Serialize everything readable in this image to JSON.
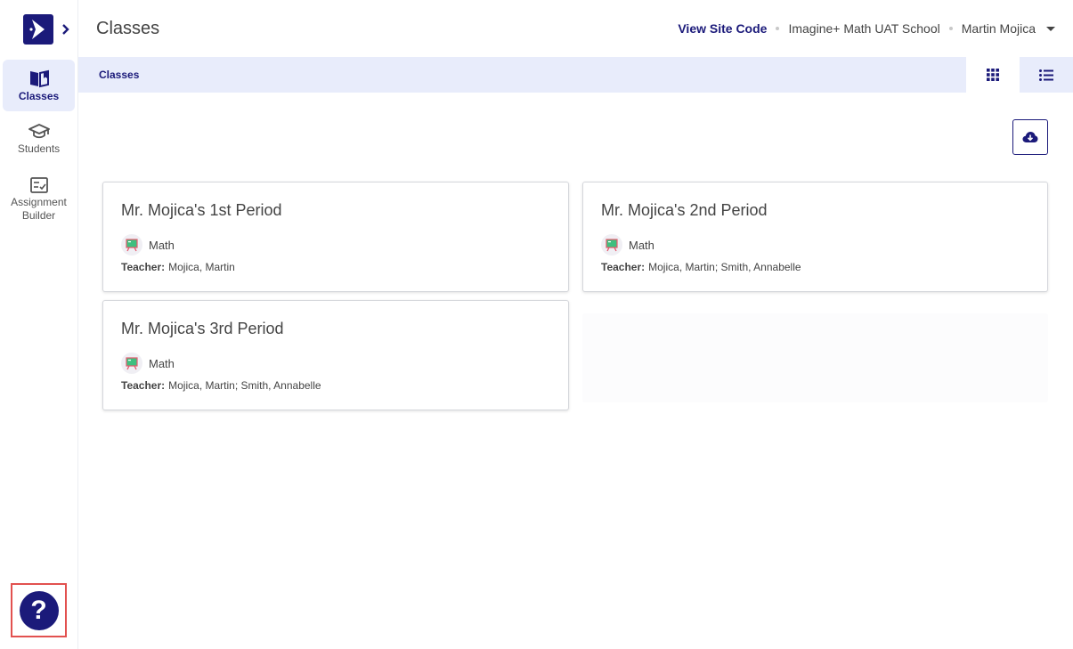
{
  "header": {
    "title": "Classes",
    "site_code_label": "View Site Code",
    "school": "Imagine+ Math UAT School",
    "user": "Martin Mojica"
  },
  "sidebar": {
    "items": [
      {
        "label": "Classes",
        "icon": "book-open-icon",
        "active": true
      },
      {
        "label": "Students",
        "icon": "graduation-cap-icon",
        "active": false
      },
      {
        "label": "Assignment Builder",
        "icon": "checklist-icon",
        "active": false
      }
    ],
    "help_label": "?"
  },
  "breadcrumb": {
    "items": [
      "Classes"
    ]
  },
  "colors": {
    "brand": "#1b1a7a",
    "active_bg": "#e8ecfb",
    "help_highlight": "#e2514f"
  },
  "classes": [
    {
      "name": "Mr. Mojica's 1st Period",
      "subject": "Math",
      "teacher_label": "Teacher:",
      "teachers": "Mojica, Martin"
    },
    {
      "name": "Mr. Mojica's 2nd Period",
      "subject": "Math",
      "teacher_label": "Teacher:",
      "teachers": "Mojica, Martin; Smith, Annabelle"
    },
    {
      "name": "Mr. Mojica's 3rd Period",
      "subject": "Math",
      "teacher_label": "Teacher:",
      "teachers": "Mojica, Martin; Smith, Annabelle"
    }
  ]
}
